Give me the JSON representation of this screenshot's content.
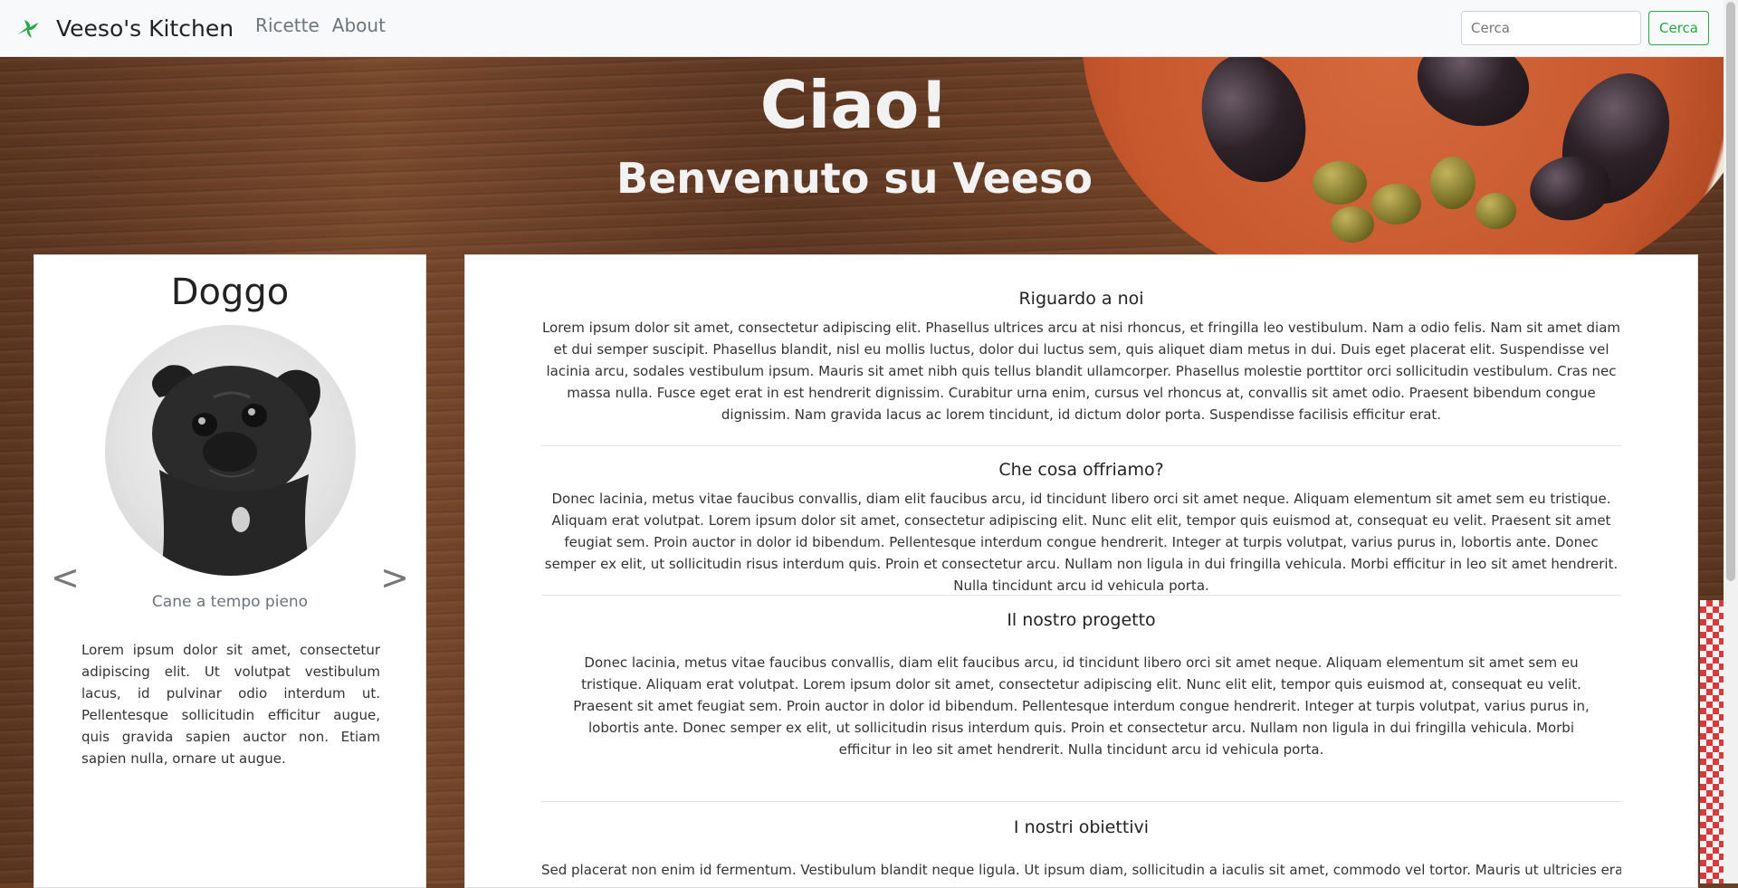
{
  "navbar": {
    "brand": "Veeso's Kitchen",
    "links": [
      "Ricette",
      "About"
    ],
    "search_placeholder": "Cerca",
    "search_button": "Cerca",
    "accent_color": "#28a745"
  },
  "hero": {
    "title": "Ciao!",
    "subtitle": "Benvenuto su Veeso"
  },
  "profile": {
    "name": "Doggo",
    "caption": "Cane a tempo pieno",
    "prev_symbol": "<",
    "next_symbol": ">",
    "bio": "Lorem ipsum dolor sit amet, consectetur adipiscing elit. Ut volutpat vestibulum lacus, id pulvinar odio interdum ut. Pellentesque sollicitudin efficitur augue, quis gravida sapien auctor non. Etiam sapien nulla, ornare ut augue."
  },
  "sections": [
    {
      "title": "Riguardo a noi",
      "text": "Lorem ipsum dolor sit amet, consectetur adipiscing elit. Phasellus ultrices arcu at nisi rhoncus, et fringilla leo vestibulum. Nam a odio felis. Nam sit amet diam et dui semper suscipit. Phasellus blandit, nisl eu mollis luctus, dolor dui luctus sem, quis aliquet diam metus in dui. Duis eget placerat elit. Suspendisse vel lacinia arcu, sodales vestibulum ipsum. Mauris sit amet nibh quis tellus blandit ullamcorper. Phasellus molestie porttitor orci sollicitudin vestibulum. Cras nec massa nulla. Fusce eget erat in est hendrerit dignissim. Curabitur urna enim, cursus vel rhoncus at, convallis sit amet odio. Praesent bibendum congue dignissim. Nam gravida lacus ac lorem tincidunt, id dictum dolor porta. Suspendisse facilisis efficitur erat."
    },
    {
      "title": "Che cosa offriamo?",
      "text": "Donec lacinia, metus vitae faucibus convallis, diam elit faucibus arcu, id tincidunt libero orci sit amet neque. Aliquam elementum sit amet sem eu tristique. Aliquam erat volutpat. Lorem ipsum dolor sit amet, consectetur adipiscing elit. Nunc elit elit, tempor quis euismod at, consequat eu velit. Praesent sit amet feugiat sem. Proin auctor in dolor id bibendum. Pellentesque interdum congue hendrerit. Integer at turpis volutpat, varius purus in, lobortis ante. Donec semper ex elit, ut sollicitudin risus interdum quis. Proin et consectetur arcu. Nullam non ligula in dui fringilla vehicula. Morbi efficitur in leo sit amet hendrerit. Nulla tincidunt arcu id vehicula porta."
    },
    {
      "title": "Il nostro progetto",
      "text": "Donec lacinia, metus vitae faucibus convallis, diam elit faucibus arcu, id tincidunt libero orci sit amet neque. Aliquam elementum sit amet sem eu tristique. Aliquam erat volutpat. Lorem ipsum dolor sit amet, consectetur adipiscing elit. Nunc elit elit, tempor quis euismod at, consequat eu velit. Praesent sit amet feugiat sem. Proin auctor in dolor id bibendum. Pellentesque interdum congue hendrerit. Integer at turpis volutpat, varius purus in, lobortis ante. Donec semper ex elit, ut sollicitudin risus interdum quis. Proin et consectetur arcu. Nullam non ligula in dui fringilla vehicula. Morbi efficitur in leo sit amet hendrerit. Nulla tincidunt arcu id vehicula porta."
    },
    {
      "title": "I nostri obiettivi",
      "text": "Sed placerat non enim id fermentum. Vestibulum blandit neque ligula. Ut ipsum diam, sollicitudin a iaculis sit amet, commodo vel tortor. Mauris ut ultricies erat, vel"
    }
  ]
}
